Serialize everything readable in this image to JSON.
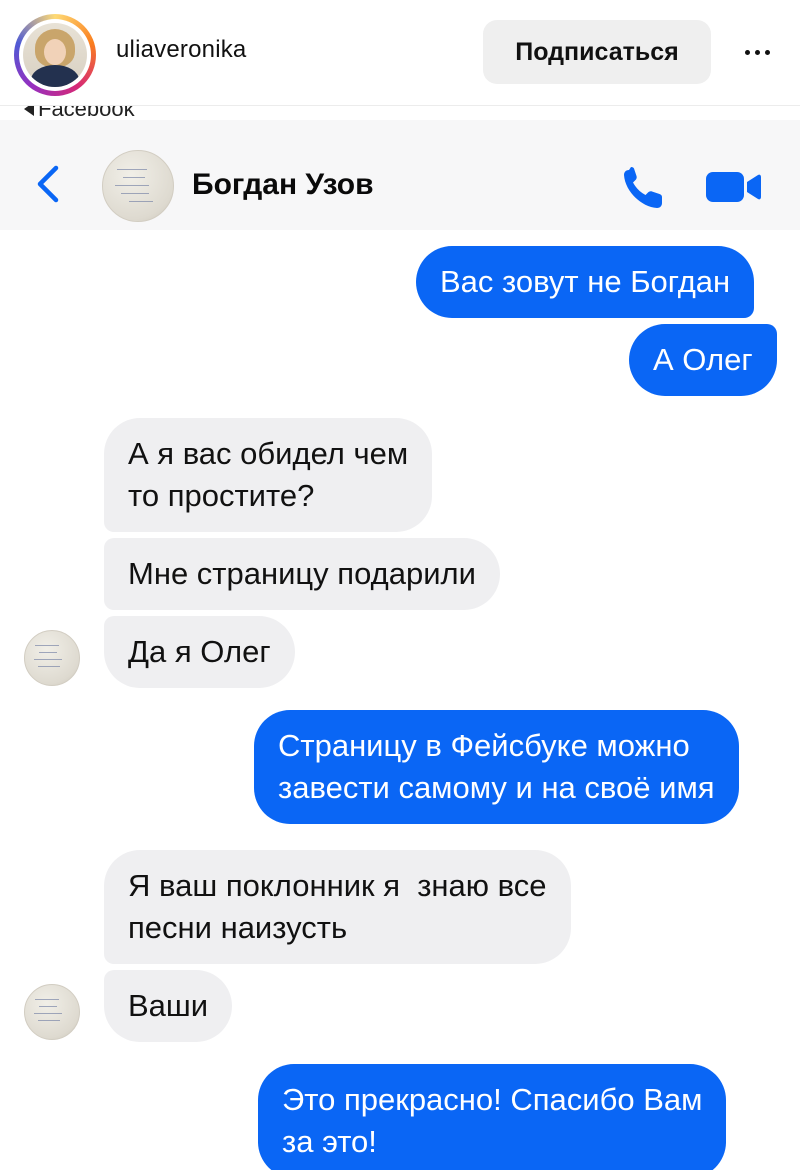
{
  "instagram": {
    "username": "uliaveronika",
    "follow_label": "Подписаться",
    "more_icon": "more-horizontal-icon"
  },
  "back_link": {
    "label": "Facebook"
  },
  "messenger": {
    "contact_name": "Богдан Узов",
    "call_icon": "phone-icon",
    "video_icon": "video-camera-icon",
    "accent_color": "#0a66f5",
    "incoming_bubble_color": "#efeff1"
  },
  "messages": [
    {
      "side": "out",
      "text": "Вас зовут не Богдан"
    },
    {
      "side": "out",
      "text": "А Олег"
    },
    {
      "side": "in",
      "lines": [
        "А я вас обидел чем",
        "то простите?"
      ]
    },
    {
      "side": "in",
      "text": "Мне страницу подарили"
    },
    {
      "side": "in",
      "text": "Да я Олег"
    },
    {
      "side": "out",
      "lines": [
        "Страницу в Фейсбуке можно",
        "завести самому и на своё имя"
      ]
    },
    {
      "side": "in",
      "lines": [
        "Я ваш поклонник я  знаю все",
        "песни наизусть"
      ]
    },
    {
      "side": "in",
      "text": "Ваши"
    },
    {
      "side": "out",
      "lines": [
        "Это прекрасно! Спасибо Вам",
        "за это!"
      ]
    }
  ]
}
